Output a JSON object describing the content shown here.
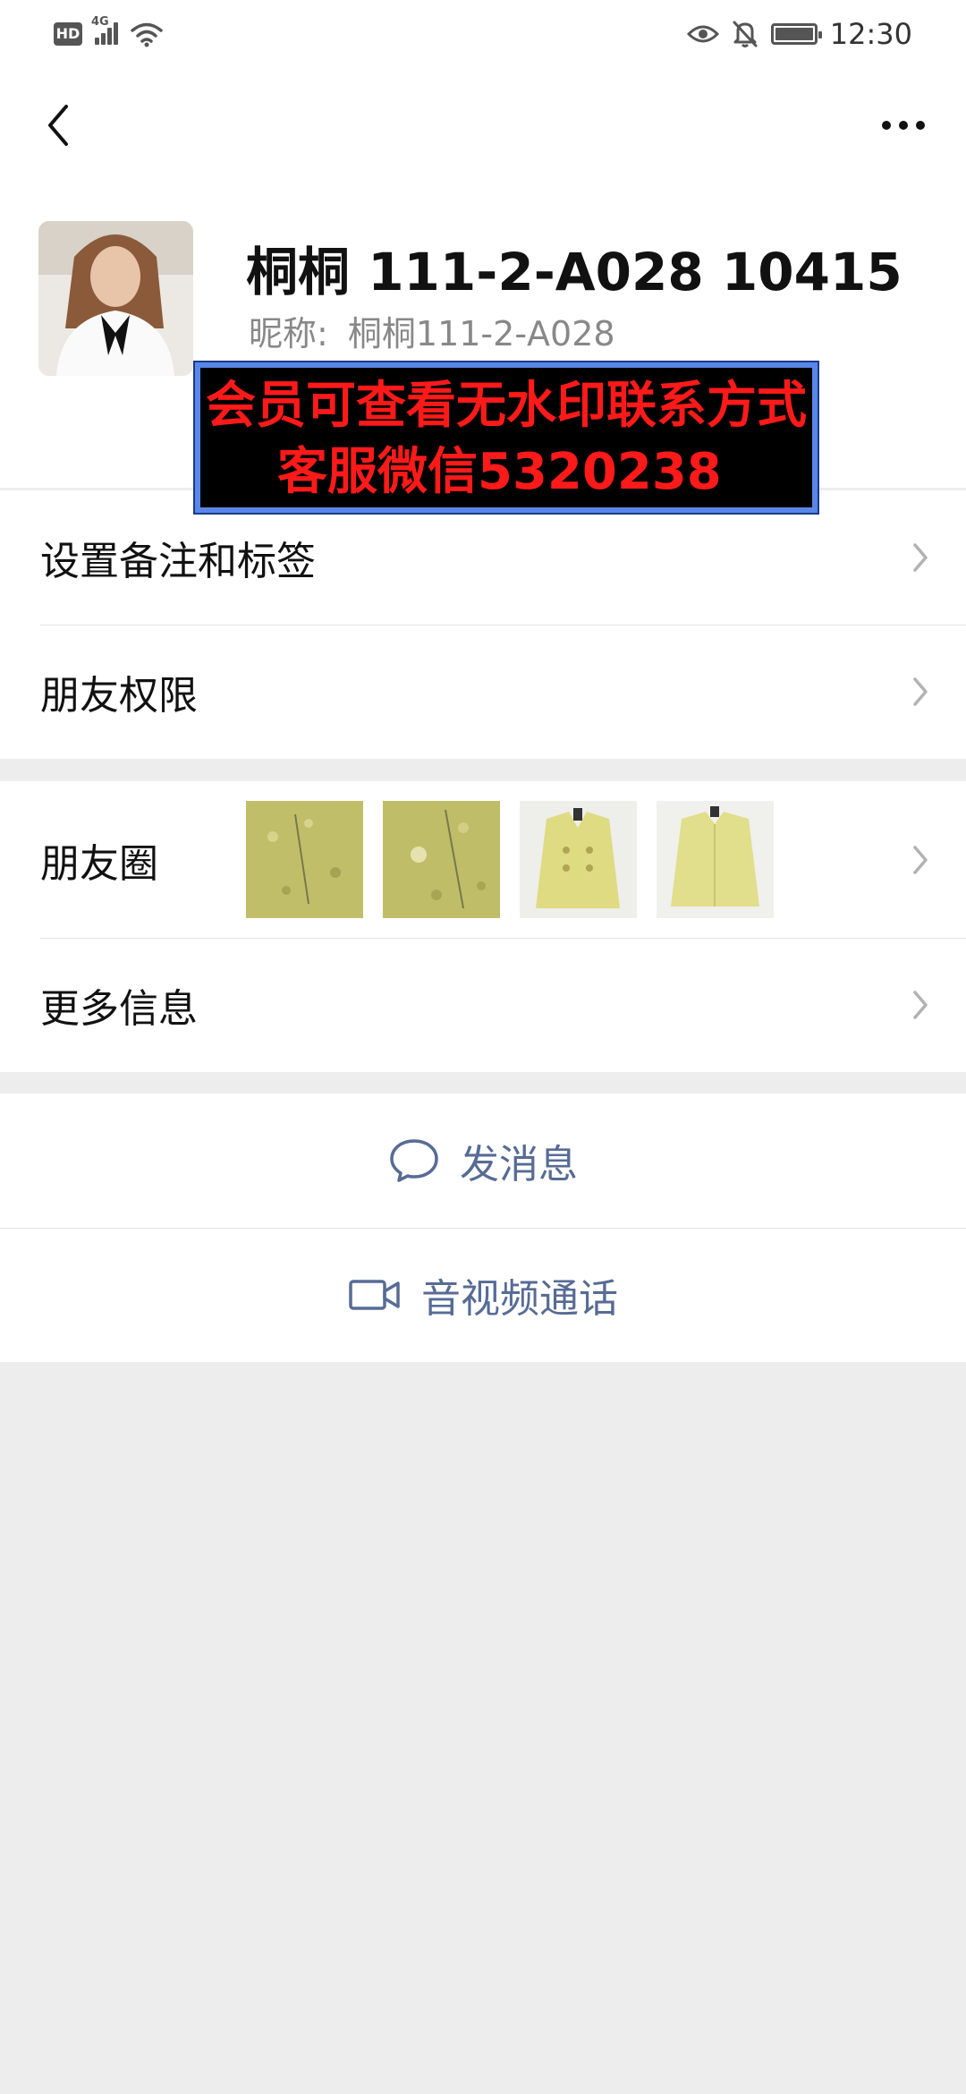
{
  "status_bar": {
    "network_badge": "HD",
    "network_type": "4G",
    "time": "12:30"
  },
  "nav": {
    "back_icon": "chevron-left-icon",
    "more_icon": "more-horizontal-icon"
  },
  "profile": {
    "name": "桐桐 111-2-A028 10415",
    "nickname_label": "昵称:",
    "nickname_value": "桐桐111-2-A028"
  },
  "watermark": {
    "line1": "会员可查看无水印联系方式",
    "line2": "客服微信5320238"
  },
  "menu": {
    "remarks_tags": "设置备注和标签",
    "friend_permissions": "朋友权限",
    "moments": "朋友圈",
    "more_info": "更多信息"
  },
  "actions": {
    "send_message": "发消息",
    "av_call": "音视频通话"
  },
  "colors": {
    "link_blue": "#576b95",
    "watermark_red": "#ff1a1a",
    "background_gray": "#ededed"
  }
}
